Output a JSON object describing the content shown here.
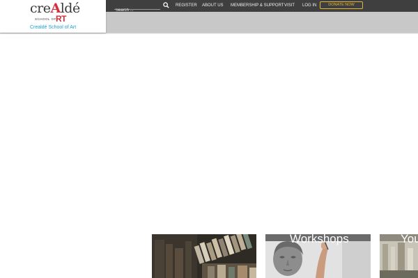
{
  "header": {
    "logo_word_1": "cre",
    "logo_accent": "A",
    "logo_word_2": "ldé",
    "logo_school": "SCHOOL OF",
    "logo_rt": "RT",
    "logo_subtitle": "Crealdé School of Art",
    "search_placeholder": "Search ...",
    "nav": [
      "REGISTER",
      "ABOUT US",
      "MEMBERSHIP & SUPPORT",
      "VISIT",
      "LOG IN"
    ],
    "donate_label": "DONATE NOW",
    "colors": {
      "topbar": "#3f3f3f",
      "subbar": "#c8c8c8",
      "accent": "#d32f3a",
      "donate": "#e3b63b",
      "logo_sub": "#1e9ecf"
    }
  },
  "tiles": [
    {
      "title": ""
    },
    {
      "title": "Workshops"
    },
    {
      "title": "You"
    }
  ]
}
